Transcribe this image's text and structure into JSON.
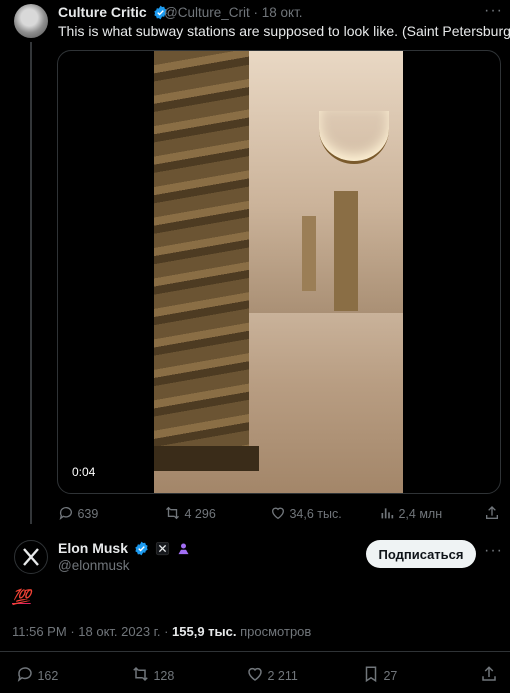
{
  "quoted": {
    "author_name": "Culture Critic",
    "handle": "@Culture_Crit",
    "date": "18 окт.",
    "text": "This is what subway stations are supposed to look like. (Saint Petersburg)",
    "video_time": "0:04",
    "stats": {
      "replies": "639",
      "reposts": "4 296",
      "likes": "34,6 тыс.",
      "views": "2,4 млн"
    }
  },
  "tweet": {
    "author_name": "Elon Musk",
    "handle": "@elonmusk",
    "follow_label": "Подписаться",
    "text": "💯",
    "time": "11:56 PM",
    "date": "18 окт. 2023 г.",
    "views_count": "155,9 тыс.",
    "views_label": "просмотров",
    "stats": {
      "replies": "162",
      "reposts": "128",
      "likes": "2 211",
      "bookmarks": "27"
    }
  },
  "colors": {
    "verified": "#1d9bf0",
    "muted": "#71767b",
    "text": "#e7e9ea",
    "background": "#000000"
  }
}
